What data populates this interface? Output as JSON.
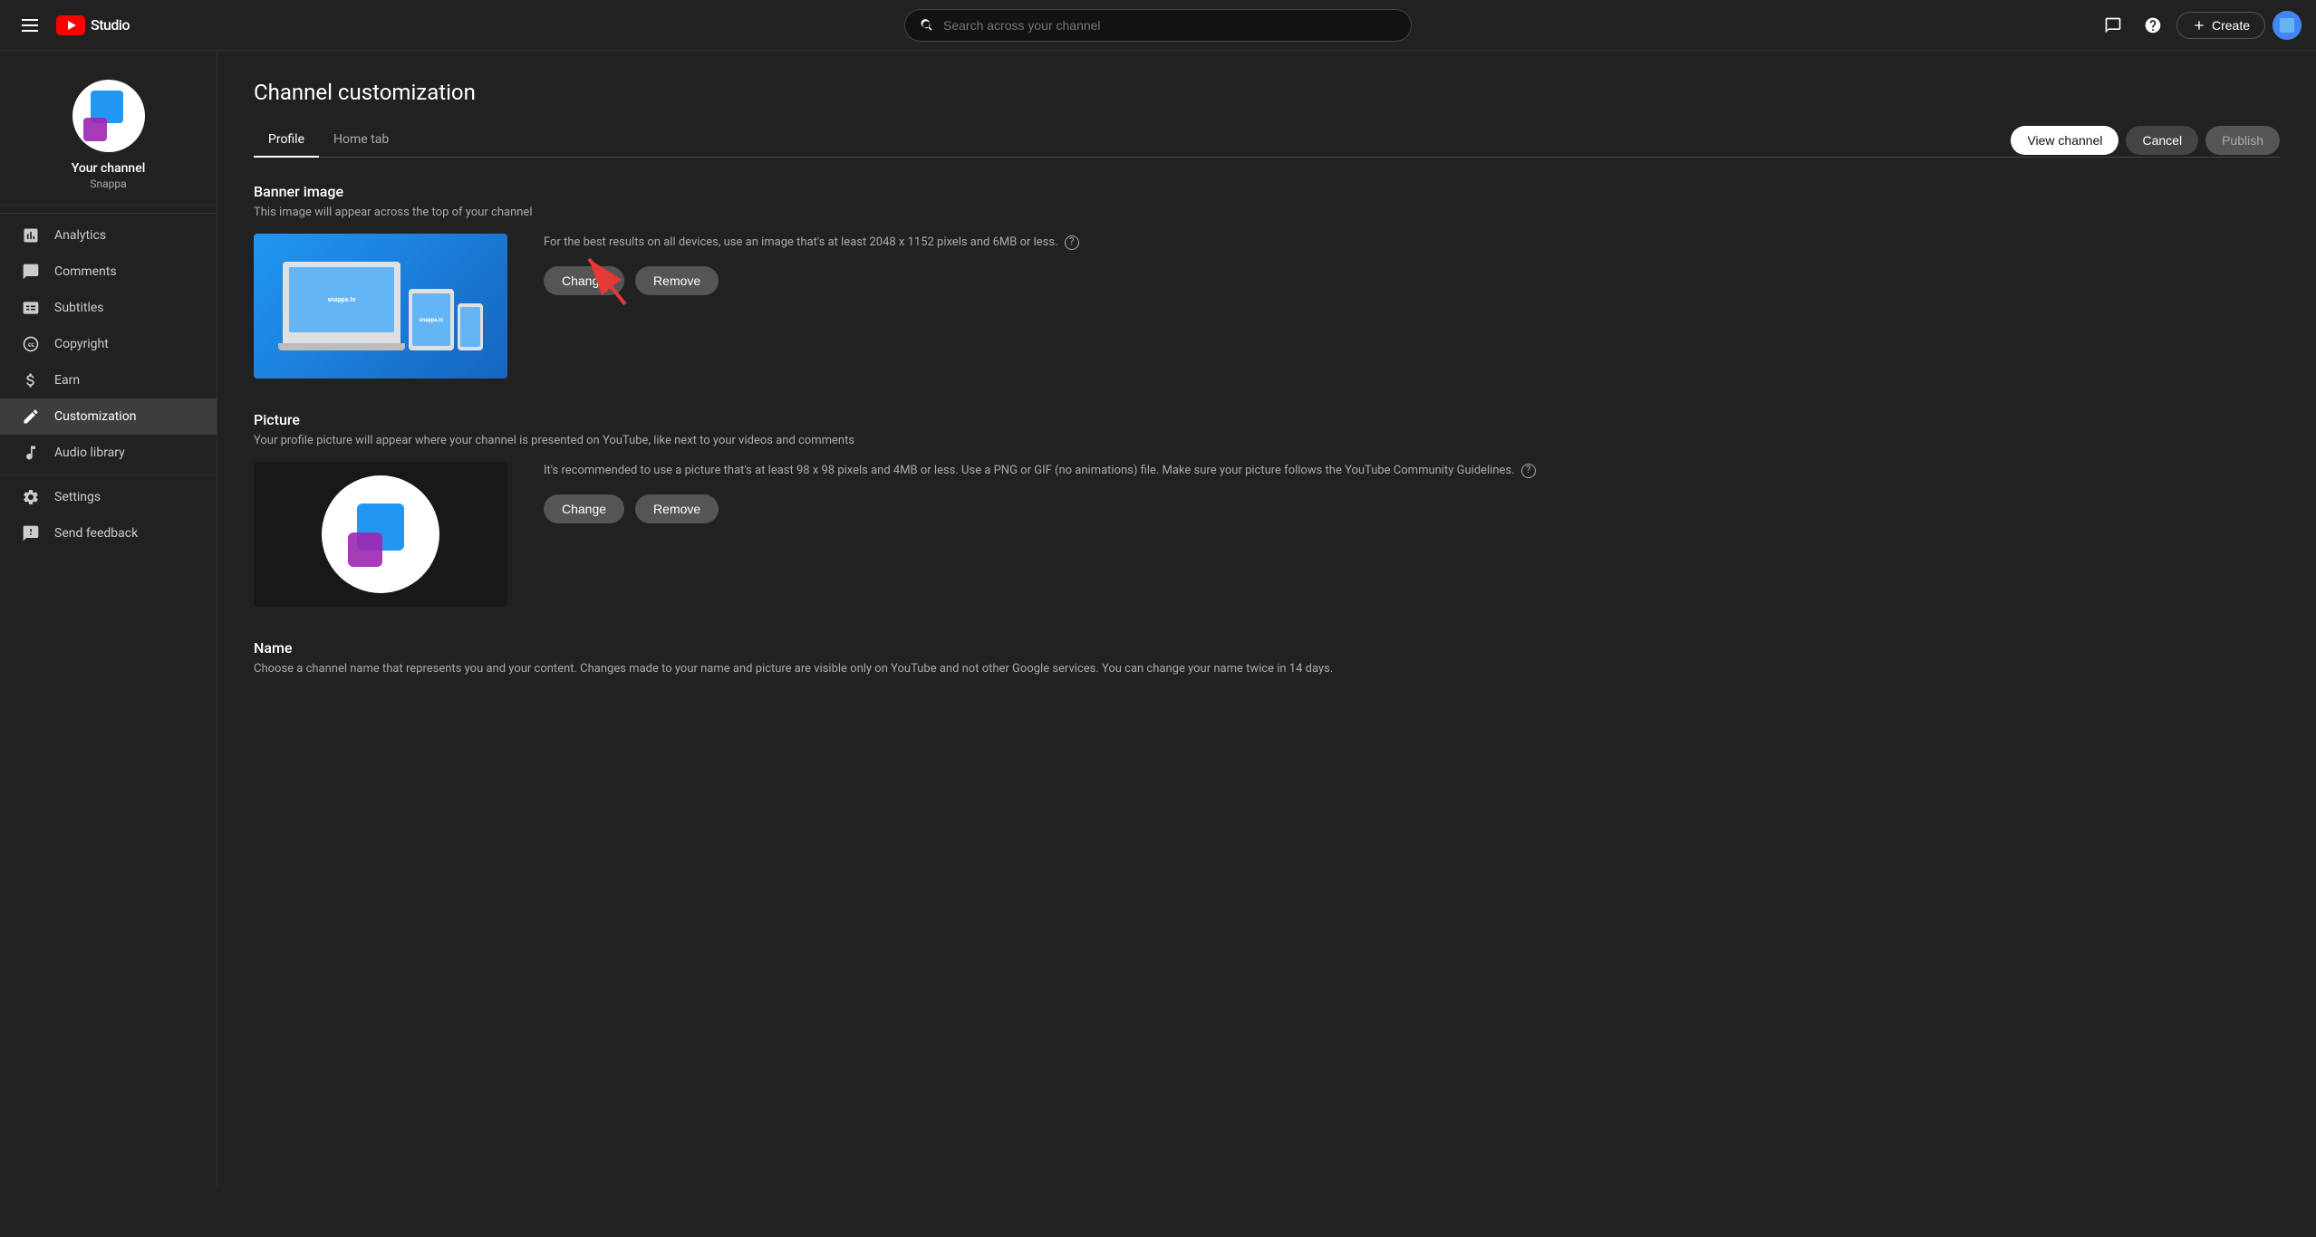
{
  "app": {
    "name": "Studio",
    "search_placeholder": "Search across your channel"
  },
  "topbar": {
    "create_label": "Create",
    "logo_label": "Studio"
  },
  "sidebar": {
    "channel_name": "Your channel",
    "channel_handle": "Snappa",
    "nav_items": [
      {
        "id": "analytics",
        "label": "Analytics",
        "icon": "analytics-icon"
      },
      {
        "id": "comments",
        "label": "Comments",
        "icon": "comments-icon"
      },
      {
        "id": "subtitles",
        "label": "Subtitles",
        "icon": "subtitles-icon"
      },
      {
        "id": "copyright",
        "label": "Copyright",
        "icon": "copyright-icon"
      },
      {
        "id": "earn",
        "label": "Earn",
        "icon": "earn-icon"
      },
      {
        "id": "customization",
        "label": "Customization",
        "icon": "customization-icon",
        "active": true
      },
      {
        "id": "audio-library",
        "label": "Audio library",
        "icon": "audio-icon"
      },
      {
        "id": "settings",
        "label": "Settings",
        "icon": "settings-icon"
      },
      {
        "id": "send-feedback",
        "label": "Send feedback",
        "icon": "feedback-icon"
      }
    ]
  },
  "page": {
    "title": "Channel customization",
    "tabs": [
      {
        "id": "profile",
        "label": "Profile",
        "active": true
      },
      {
        "id": "home-tab",
        "label": "Home tab",
        "active": false
      }
    ],
    "actions": {
      "view_channel": "View channel",
      "cancel": "Cancel",
      "publish": "Publish"
    }
  },
  "sections": {
    "banner": {
      "title": "Banner image",
      "description": "This image will appear across the top of your channel",
      "info_text": "For the best results on all devices, use an image that's at least 2048 x 1152 pixels and 6MB or less.",
      "banner_text": "snappa.tv",
      "btn_change": "Change",
      "btn_remove": "Remove"
    },
    "picture": {
      "title": "Picture",
      "description": "Your profile picture will appear where your channel is presented on YouTube, like next to your videos and comments",
      "info_text": "It's recommended to use a picture that's at least 98 x 98 pixels and 4MB or less. Use a PNG or GIF (no animations) file. Make sure your picture follows the YouTube Community Guidelines.",
      "btn_change": "Change",
      "btn_remove": "Remove"
    },
    "name": {
      "title": "Name",
      "description": "Choose a channel name that represents you and your content. Changes made to your name and picture are visible only on YouTube and not other Google services. You can change your name twice in 14 days."
    }
  }
}
